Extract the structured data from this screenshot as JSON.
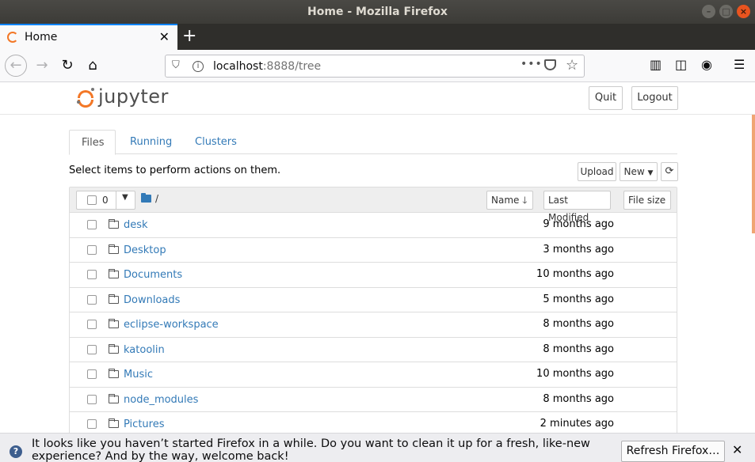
{
  "window": {
    "title": "Home - Mozilla Firefox"
  },
  "browser": {
    "tab_title": "Home",
    "url_host": "localhost",
    "url_rest": ":8888/tree"
  },
  "jupyter": {
    "logo_text": "jupyter",
    "quit_label": "Quit",
    "logout_label": "Logout",
    "tabs": [
      {
        "label": "Files"
      },
      {
        "label": "Running"
      },
      {
        "label": "Clusters"
      }
    ],
    "hint": "Select items to perform actions on them.",
    "upload_label": "Upload",
    "new_label": "New",
    "selected_count": "0",
    "path": "/",
    "columns": {
      "name": "Name",
      "modified": "Last Modified",
      "size": "File size"
    },
    "files": [
      {
        "name": "desk",
        "modified": "9 months ago"
      },
      {
        "name": "Desktop",
        "modified": "3 months ago"
      },
      {
        "name": "Documents",
        "modified": "10 months ago"
      },
      {
        "name": "Downloads",
        "modified": "5 months ago"
      },
      {
        "name": "eclipse-workspace",
        "modified": "8 months ago"
      },
      {
        "name": "katoolin",
        "modified": "8 months ago"
      },
      {
        "name": "Music",
        "modified": "10 months ago"
      },
      {
        "name": "node_modules",
        "modified": "8 months ago"
      },
      {
        "name": "Pictures",
        "modified": "2 minutes ago"
      }
    ]
  },
  "notification": {
    "text": "It looks like you haven’t started Firefox in a while. Do you want to clean it up for a fresh, like-new experience? And by the way, welcome back!",
    "button_label": "Refresh Firefox…"
  },
  "colors": {
    "accent": "#f37726",
    "link": "#337ab7",
    "firefox_blue": "#0a84ff"
  }
}
